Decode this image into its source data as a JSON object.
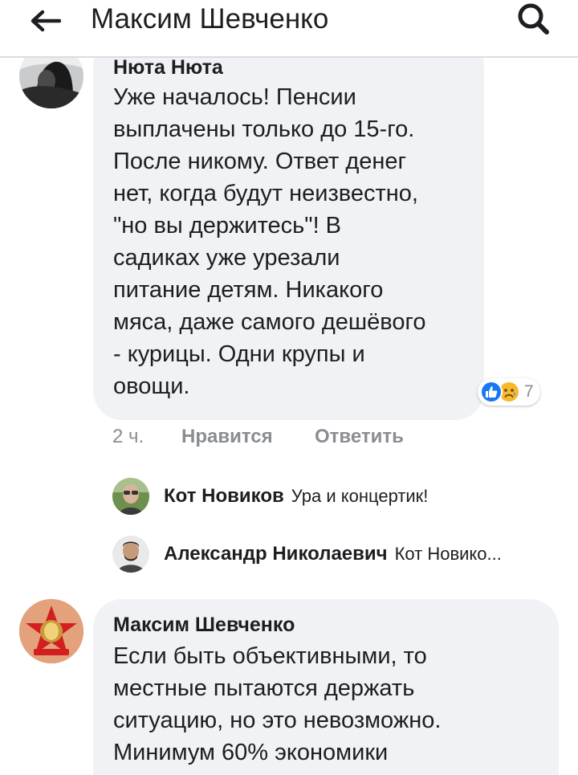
{
  "header": {
    "title": "Максим Шевченко",
    "back_icon": "back-arrow-icon",
    "search_icon": "search-icon"
  },
  "comments": [
    {
      "author": "Нюта Нюта",
      "lines": [
        "Уже началось! Пенсии",
        "выплачены только до 15-го.",
        "После никому. Ответ денег",
        "нет, когда будут неизвестно,",
        "\"но вы держитесь\"! В",
        "садиках уже урезали",
        "питание детям. Никакого",
        "мяса, даже самого дешёвого",
        "- курицы. Одни крупы и",
        "овощи."
      ],
      "time": "2 ч.",
      "like_label": "Нравится",
      "reply_label": "Ответить",
      "reactions": {
        "icons": [
          "like-icon",
          "sad-icon"
        ],
        "count": "7"
      },
      "replies": [
        {
          "author": "Кот Новиков",
          "text": "Ура и концертик!"
        },
        {
          "author": "Александр Николаевич",
          "text": "Кот Новико..."
        }
      ]
    },
    {
      "author": "Максим Шевченко",
      "lines": [
        "Если быть объективными, то",
        "местные пытаются держать",
        "ситуацию, но это невозможно.",
        "Минимум 60% экономики"
      ]
    }
  ],
  "colors": {
    "bubble": "#f0f2f5",
    "text": "#1c1e21",
    "muted": "#8a8d91",
    "like_blue": "#1877f2",
    "sad_yellow": "#f7b928"
  }
}
